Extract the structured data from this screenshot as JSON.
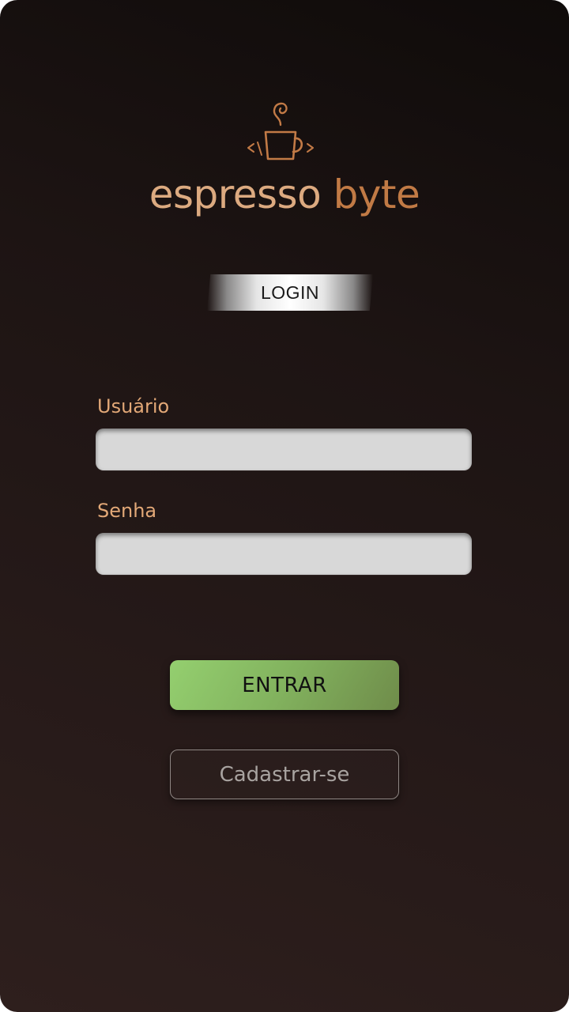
{
  "brand": {
    "word1": "espresso",
    "word2": "byte",
    "icon": "coffee-cup-code-icon",
    "colors": {
      "primary": "#dcaa80",
      "accent": "#c17a45"
    }
  },
  "header": {
    "title": "LOGIN"
  },
  "form": {
    "username_label": "Usuário",
    "username_value": "",
    "password_label": "Senha",
    "password_value": ""
  },
  "actions": {
    "submit_label": "ENTRAR",
    "register_label": "Cadastrar-se"
  },
  "colors": {
    "background_dark": "#0f0b0a",
    "background_light": "#2e1f1d",
    "label": "#e2a877",
    "submit_button": "#82b25e",
    "input_fill": "#d8d8d8"
  }
}
